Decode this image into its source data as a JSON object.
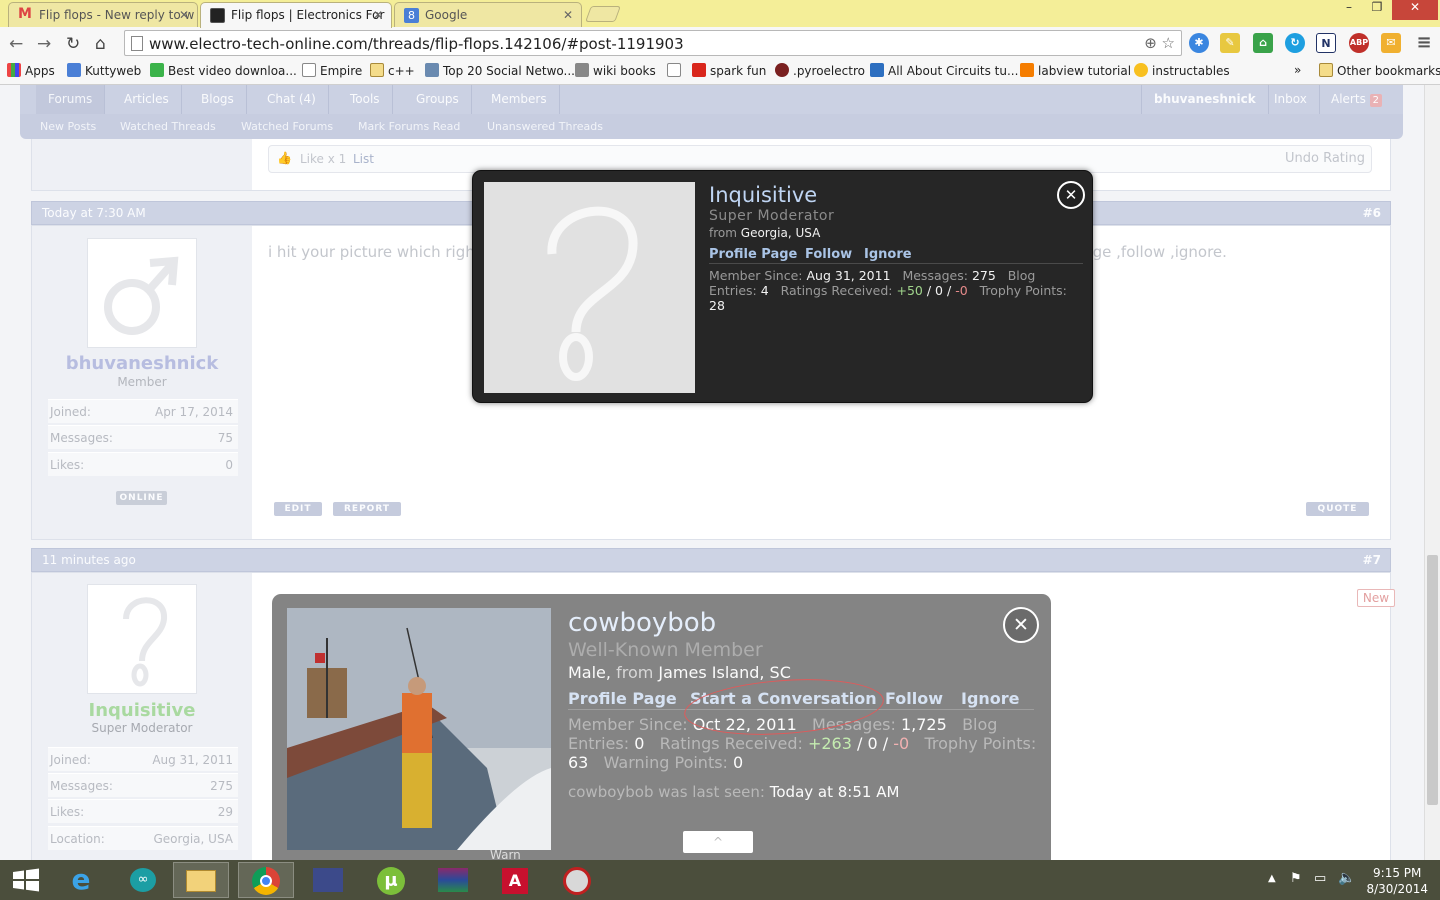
{
  "browser": {
    "tabs": [
      {
        "title": "Flip flops - New reply to w",
        "active": false,
        "favicon": "gmail-icon"
      },
      {
        "title": "Flip flops | Electronics For",
        "active": true,
        "favicon": "eto-icon"
      },
      {
        "title": "Google",
        "active": false,
        "favicon": "google-icon"
      }
    ],
    "url": "www.electro-tech-online.com/threads/flip-flops.142106/#post-1191903",
    "window_controls": {
      "minimize": "–",
      "maximize": "❐",
      "close": "✕"
    }
  },
  "bookmarks": [
    {
      "label": "Apps",
      "icon": "apps-icon"
    },
    {
      "label": "Kuttyweb",
      "icon": "kuttyweb-icon"
    },
    {
      "label": "Best video downloa...",
      "icon": "video-icon"
    },
    {
      "label": "Empire",
      "icon": "page-icon"
    },
    {
      "label": "c++",
      "icon": "folder-icon"
    },
    {
      "label": "Top 20 Social Netwo...",
      "icon": "social-icon"
    },
    {
      "label": "wiki books",
      "icon": "wiki-icon"
    },
    {
      "label": "",
      "icon": "page-icon"
    },
    {
      "label": "spark fun",
      "icon": "sparkfun-icon"
    },
    {
      "label": ".pyroelectro",
      "icon": "pyro-icon"
    },
    {
      "label": "All About Circuits tu...",
      "icon": "circuits-icon"
    },
    {
      "label": "labview tutorial",
      "icon": "blogger-icon"
    },
    {
      "label": "instructables",
      "icon": "instructables-icon"
    }
  ],
  "bookmarks_more": "»",
  "other_bookmarks": "Other bookmarks",
  "forum": {
    "nav": [
      "Forums",
      "Articles",
      "Blogs",
      "Chat (4)",
      "Tools",
      "Groups",
      "Members"
    ],
    "user_nav": {
      "username": "bhuvaneshnick",
      "inbox": "Inbox",
      "alerts": "Alerts",
      "alerts_count": "2"
    },
    "subnav": [
      "New Posts",
      "Watched Threads",
      "Watched Forums",
      "Mark Forums Read",
      "Unanswered Threads"
    ],
    "like_bar": {
      "like": "Like x 1",
      "list": "List",
      "undo": "Undo Rating"
    },
    "posts": [
      {
        "time": "Today at 7:30 AM",
        "num": "#6",
        "username": "bhuvaneshnick",
        "role": "Member",
        "stats": [
          {
            "label": "Joined:",
            "value": "Apr 17, 2014"
          },
          {
            "label": "Messages:",
            "value": "75"
          },
          {
            "label": "Likes:",
            "value": "0"
          }
        ],
        "status": "ONLINE",
        "text_left": "i hit your picture which right c",
        "text_right": "on\".all it have is profile page ,follow ,ignore.",
        "buttons": {
          "edit": "EDIT",
          "report": "REPORT",
          "quote": "QUOTE"
        }
      },
      {
        "time": "11 minutes ago",
        "num": "#7",
        "username": "Inquisitive",
        "role": "Super Moderator",
        "stats": [
          {
            "label": "Joined:",
            "value": "Aug 31, 2011"
          },
          {
            "label": "Messages:",
            "value": "275"
          },
          {
            "label": "Likes:",
            "value": "29"
          },
          {
            "label": "Location:",
            "value": "Georgia, USA"
          }
        ],
        "new_badge": "New",
        "warn": "Warn"
      }
    ]
  },
  "popup_inquisitive": {
    "name": "Inquisitive",
    "role": "Super Moderator",
    "from_label": "from",
    "location": "Georgia, USA",
    "links": [
      "Profile Page",
      "Follow",
      "Ignore"
    ],
    "member_since_label": "Member Since:",
    "member_since": "Aug 31, 2011",
    "messages_label": "Messages:",
    "messages": "275",
    "blog_label": "Blog Entries:",
    "blog_entries": "4",
    "ratings_label": "Ratings Received:",
    "ratings_pos": "+50",
    "ratings_neutral": "0",
    "ratings_neg": "-0",
    "trophy_label": "Trophy Points:",
    "trophy": "28"
  },
  "popup_cowboybob": {
    "name": "cowboybob",
    "role": "Well-Known Member",
    "gender": "Male,",
    "from_label": "from",
    "location": "James Island, SC",
    "links": [
      "Profile Page",
      "Start a Conversation",
      "Follow",
      "Ignore"
    ],
    "member_since_label": "Member Since:",
    "member_since": "Oct 22, 2011",
    "messages_label": "Messages:",
    "messages": "1,725",
    "blog_label": "Blog Entries:",
    "blog_entries": "0",
    "ratings_label": "Ratings Received:",
    "ratings_pos": "+263",
    "ratings_neutral": "0",
    "ratings_neg": "-0",
    "trophy_label": "Trophy Points:",
    "trophy": "63",
    "warning_label": "Warning Points:",
    "warning": "0",
    "seen_text": "cowboybob was last seen:",
    "seen_time": "Today at 8:51 AM",
    "collapse": "^"
  },
  "taskbar": {
    "apps": [
      "start-icon",
      "ie-icon",
      "arduino-icon",
      "explorer-icon",
      "chrome-icon",
      "app-icon",
      "utorrent-icon",
      "winrar-icon",
      "adobe-icon",
      "media-icon"
    ],
    "time": "9:15 PM",
    "date": "8/30/2014"
  }
}
